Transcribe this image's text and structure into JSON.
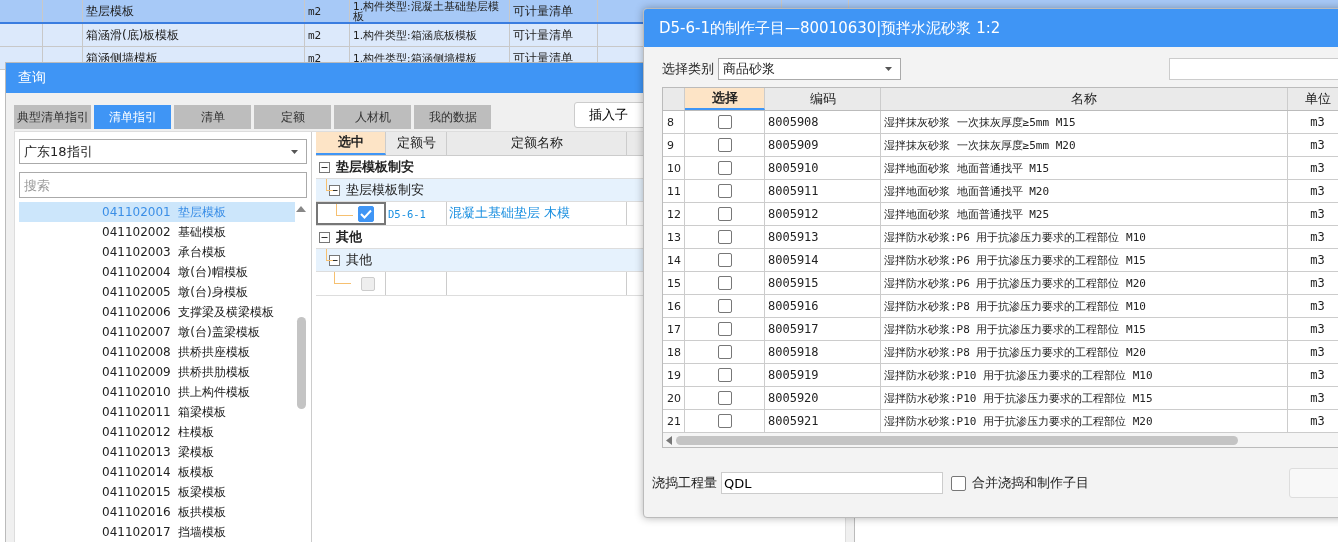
{
  "background_table": {
    "rows": [
      {
        "selected": true,
        "name": "垫层模板",
        "unit": "m2",
        "feature": "1.构件类型:混凝土基础垫层模板",
        "type": "可计量清单",
        "extra": []
      },
      {
        "selected": false,
        "name": "箱涵滑(底)板模板",
        "unit": "m2",
        "feature": "1.构件类型:箱涵底板模板",
        "type": "可计量清单",
        "extra": []
      },
      {
        "selected": false,
        "name": "箱涵侧墙模板",
        "unit": "m2",
        "feature": "1.构件类型:箱涵侧墙模板",
        "type": "可计量清单",
        "extra": []
      }
    ]
  },
  "query_dialog": {
    "title": "查询",
    "tabs": [
      {
        "label": "典型清单指引",
        "selected": false
      },
      {
        "label": "清单指引",
        "selected": true
      },
      {
        "label": "清单",
        "selected": false
      },
      {
        "label": "定额",
        "selected": false
      },
      {
        "label": "人材机",
        "selected": false
      },
      {
        "label": "我的数据",
        "selected": false
      }
    ],
    "insert_button": "插入子",
    "guide_select": "广东18指引",
    "search": {
      "placeholder": "搜索"
    },
    "items": [
      {
        "code": "041102001",
        "name": "垫层模板",
        "selected": true
      },
      {
        "code": "041102002",
        "name": "基础模板",
        "selected": false
      },
      {
        "code": "041102003",
        "name": "承台模板",
        "selected": false
      },
      {
        "code": "041102004",
        "name": "墩(台)帽模板",
        "selected": false
      },
      {
        "code": "041102005",
        "name": "墩(台)身模板",
        "selected": false
      },
      {
        "code": "041102006",
        "name": "支撑梁及横梁模板",
        "selected": false
      },
      {
        "code": "041102007",
        "name": "墩(台)盖梁模板",
        "selected": false
      },
      {
        "code": "041102008",
        "name": "拱桥拱座模板",
        "selected": false
      },
      {
        "code": "041102009",
        "name": "拱桥拱肋模板",
        "selected": false
      },
      {
        "code": "041102010",
        "name": "拱上构件模板",
        "selected": false
      },
      {
        "code": "041102011",
        "name": "箱梁模板",
        "selected": false
      },
      {
        "code": "041102012",
        "name": "柱模板",
        "selected": false
      },
      {
        "code": "041102013",
        "name": "梁模板",
        "selected": false
      },
      {
        "code": "041102014",
        "name": "板模板",
        "selected": false
      },
      {
        "code": "041102015",
        "name": "板梁模板",
        "selected": false
      },
      {
        "code": "041102016",
        "name": "板拱模板",
        "selected": false
      },
      {
        "code": "041102017",
        "name": "挡墙模板",
        "selected": false
      }
    ],
    "quota_table": {
      "columns": [
        "选中",
        "定额号",
        "定额名称"
      ],
      "groups": [
        {
          "label": "垫层模板制安",
          "expanded": true,
          "children": [
            {
              "label": "垫层模板制安",
              "expanded": true,
              "children": [
                {
                  "checked": true,
                  "disabled": false,
                  "code": "D5-6-1",
                  "name": "混凝土基础垫层 木模"
                }
              ]
            }
          ]
        },
        {
          "label": "其他",
          "expanded": true,
          "children": [
            {
              "label": "其他",
              "expanded": true,
              "children": [
                {
                  "checked": false,
                  "disabled": true
                }
              ]
            }
          ]
        }
      ]
    }
  },
  "sub_dialog": {
    "title": "D5-6-1的制作子目—80010630|预拌水泥砂浆 1:2",
    "category_label": "选择类别",
    "category": "商品砂浆",
    "columns": [
      "选择",
      "编码",
      "名称",
      "单位"
    ],
    "rows": [
      {
        "no": "8",
        "checked": false,
        "code": "8005908",
        "name": "湿拌抹灰砂浆 一次抹灰厚度≥5mm M15",
        "unit": "m3"
      },
      {
        "no": "9",
        "checked": false,
        "code": "8005909",
        "name": "湿拌抹灰砂浆 一次抹灰厚度≥5mm M20",
        "unit": "m3"
      },
      {
        "no": "10",
        "checked": false,
        "code": "8005910",
        "name": "湿拌地面砂浆 地面普通找平 M15",
        "unit": "m3"
      },
      {
        "no": "11",
        "checked": false,
        "code": "8005911",
        "name": "湿拌地面砂浆 地面普通找平 M20",
        "unit": "m3"
      },
      {
        "no": "12",
        "checked": false,
        "code": "8005912",
        "name": "湿拌地面砂浆 地面普通找平 M25",
        "unit": "m3"
      },
      {
        "no": "13",
        "checked": false,
        "code": "8005913",
        "name": "湿拌防水砂浆:P6 用于抗渗压力要求的工程部位 M10",
        "unit": "m3"
      },
      {
        "no": "14",
        "checked": false,
        "code": "8005914",
        "name": "湿拌防水砂浆:P6 用于抗渗压力要求的工程部位 M15",
        "unit": "m3"
      },
      {
        "no": "15",
        "checked": false,
        "code": "8005915",
        "name": "湿拌防水砂浆:P6 用于抗渗压力要求的工程部位 M20",
        "unit": "m3"
      },
      {
        "no": "16",
        "checked": false,
        "code": "8005916",
        "name": "湿拌防水砂浆:P8 用于抗渗压力要求的工程部位 M10",
        "unit": "m3"
      },
      {
        "no": "17",
        "checked": false,
        "code": "8005917",
        "name": "湿拌防水砂浆:P8 用于抗渗压力要求的工程部位 M15",
        "unit": "m3"
      },
      {
        "no": "18",
        "checked": false,
        "code": "8005918",
        "name": "湿拌防水砂浆:P8 用于抗渗压力要求的工程部位 M20",
        "unit": "m3"
      },
      {
        "no": "19",
        "checked": false,
        "code": "8005919",
        "name": "湿拌防水砂浆:P10 用于抗渗压力要求的工程部位 M10",
        "unit": "m3"
      },
      {
        "no": "20",
        "checked": false,
        "code": "8005920",
        "name": "湿拌防水砂浆:P10 用于抗渗压力要求的工程部位 M15",
        "unit": "m3"
      },
      {
        "no": "21",
        "checked": false,
        "code": "8005921",
        "name": "湿拌防水砂浆:P10 用于抗渗压力要求的工程部位 M20",
        "unit": "m3"
      }
    ],
    "quantity_label": "浇捣工程量",
    "quantity": "QDL",
    "merge": {
      "label": "合并浇捣和制作子目",
      "checked": false
    }
  }
}
